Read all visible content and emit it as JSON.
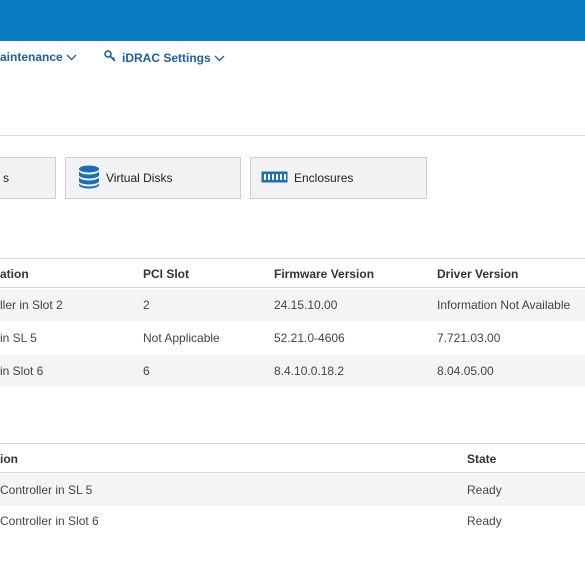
{
  "nav": {
    "items": [
      {
        "label": "aintenance"
      },
      {
        "label": "iDRAC Settings"
      }
    ]
  },
  "tiles": [
    {
      "label": "s"
    },
    {
      "label": "Virtual Disks"
    },
    {
      "label": "Enclosures"
    }
  ],
  "controllers_table": {
    "headers": [
      "ation",
      "PCI Slot",
      "Firmware Version",
      "Driver Version"
    ],
    "rows": [
      [
        "ller in Slot 2",
        "2",
        "24.15.10.00",
        "Information Not Available"
      ],
      [
        "in SL 5",
        "Not Applicable",
        "52.21.0-4606",
        "7.721.03.00"
      ],
      [
        "in Slot 6",
        "6",
        "8.4.10.0.18.2",
        "8.04.05.00"
      ]
    ]
  },
  "state_table": {
    "headers": [
      "ion",
      "State"
    ],
    "rows": [
      [
        "Controller in SL 5",
        "Ready"
      ],
      [
        "Controller in Slot 6",
        "Ready"
      ]
    ]
  }
}
